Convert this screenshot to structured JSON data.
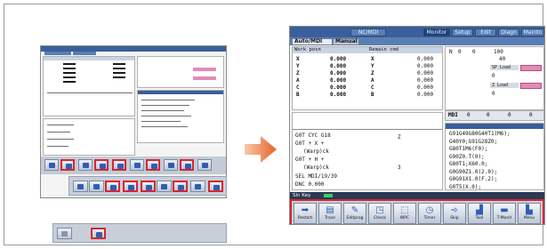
{
  "large_screen": {
    "top_tabs": [
      "NC/MDI",
      "Monitor",
      "Setup",
      "Edit",
      "Diagn",
      "Maintn"
    ],
    "sub_tabs": [
      "Auto/MDI",
      "Manual"
    ],
    "coord_headers": [
      "Work posn",
      "Remain cmd"
    ],
    "axes": [
      "X",
      "Y",
      "Z",
      "A",
      "C",
      "B"
    ],
    "work_values": [
      "0.000",
      "0.000",
      "0.000",
      "0.000",
      "0.000",
      "0.000"
    ],
    "remain_values": [
      "0.000",
      "0.000",
      "0.000",
      "0.000",
      "0.000",
      "0.000"
    ],
    "right_info": {
      "n_label": "N",
      "n_val": "0",
      "g_val": "0",
      "s_val": "100",
      "t_val": "40",
      "sp_load": "SP Load",
      "z_load": "Z Load",
      "zero": "0",
      "zero2": "0"
    },
    "mdi_row": {
      "label": "MDI",
      "a": "0",
      "b": "0",
      "c": "0",
      "d": "0"
    },
    "program_lines": [
      "G91G49G80G40T1(M6);",
      "G40Y0;G91G28Z0;",
      "G80T1M6(F0);",
      "G90Z0.T(0);",
      "G80T1;X60.0;",
      "G0G90Z1.0(2.0);",
      "G0G91X1.0(F.2);",
      "G0T5(X.0);"
    ],
    "lower_left": {
      "line1": "G0T  CYC G18",
      "line2": "G0T  + X  +",
      "line3": "(Warp)ck",
      "line4": "G0T  + H  +",
      "line5": "(Warp)ck",
      "line6": "SEL  MDI/19/39",
      "line7": "DNC  0.000",
      "side1": "Z",
      "side2": "3"
    },
    "status_text": "Sln Key",
    "softkeys": [
      {
        "icon": "arrow-right-icon",
        "glyph": "➡",
        "label": "Restart"
      },
      {
        "icon": "tape-icon",
        "glyph": "▤",
        "label": "Trace"
      },
      {
        "icon": "edit-icon",
        "glyph": "✎",
        "label": "Editprog"
      },
      {
        "icon": "chart-icon",
        "glyph": "◳",
        "label": "Check"
      },
      {
        "icon": "wpc-icon",
        "glyph": "⬚",
        "label": "WPC"
      },
      {
        "icon": "clock-icon",
        "glyph": "◷",
        "label": "Timer"
      },
      {
        "icon": "jump-icon",
        "glyph": "➾",
        "label": "Skip"
      },
      {
        "icon": "graph-icon",
        "glyph": "▟",
        "label": "Tool"
      },
      {
        "icon": "bar-icon",
        "glyph": "▬",
        "label": "T-Monit"
      },
      {
        "icon": "folder-icon",
        "glyph": "▙",
        "label": "Menu"
      }
    ]
  },
  "colors": {
    "highlight": "#d9262f",
    "title_bar": "#3a5f9a",
    "gauge": "#e38ab6",
    "arrow": "#e8622d"
  }
}
